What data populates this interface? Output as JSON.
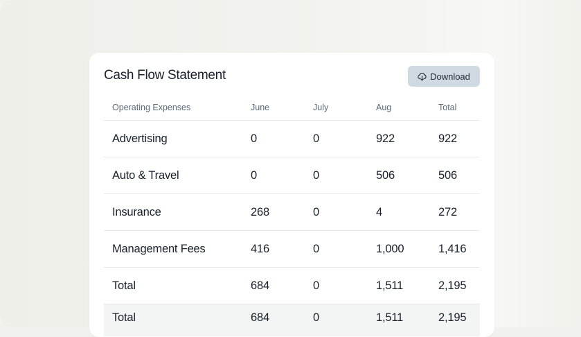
{
  "card": {
    "title": "Cash Flow Statement",
    "download_label": "Download",
    "download_icon": "cloud-download-icon"
  },
  "table": {
    "headers": [
      "Operating Expenses",
      "June",
      "July",
      "Aug",
      "Total"
    ],
    "rows": [
      [
        "Advertising",
        "0",
        "0",
        "922",
        "922"
      ],
      [
        "Auto & Travel",
        "0",
        "0",
        "506",
        "506"
      ],
      [
        "Insurance",
        "268",
        "0",
        "4",
        "272"
      ],
      [
        "Management Fees",
        "416",
        "0",
        "1,000",
        "1,416"
      ],
      [
        "Total",
        "684",
        "0",
        "1,511",
        "2,195"
      ]
    ],
    "footer": [
      "Total",
      "684",
      "0",
      "1,511",
      "2,195"
    ]
  },
  "colors": {
    "page_background": "#f1f1ed",
    "card_background": "#ffffff",
    "button_background": "#cfd9e1",
    "footer_row_background": "#f3f5f4",
    "text_primary": "#17202b",
    "text_header": "#5b6875"
  }
}
